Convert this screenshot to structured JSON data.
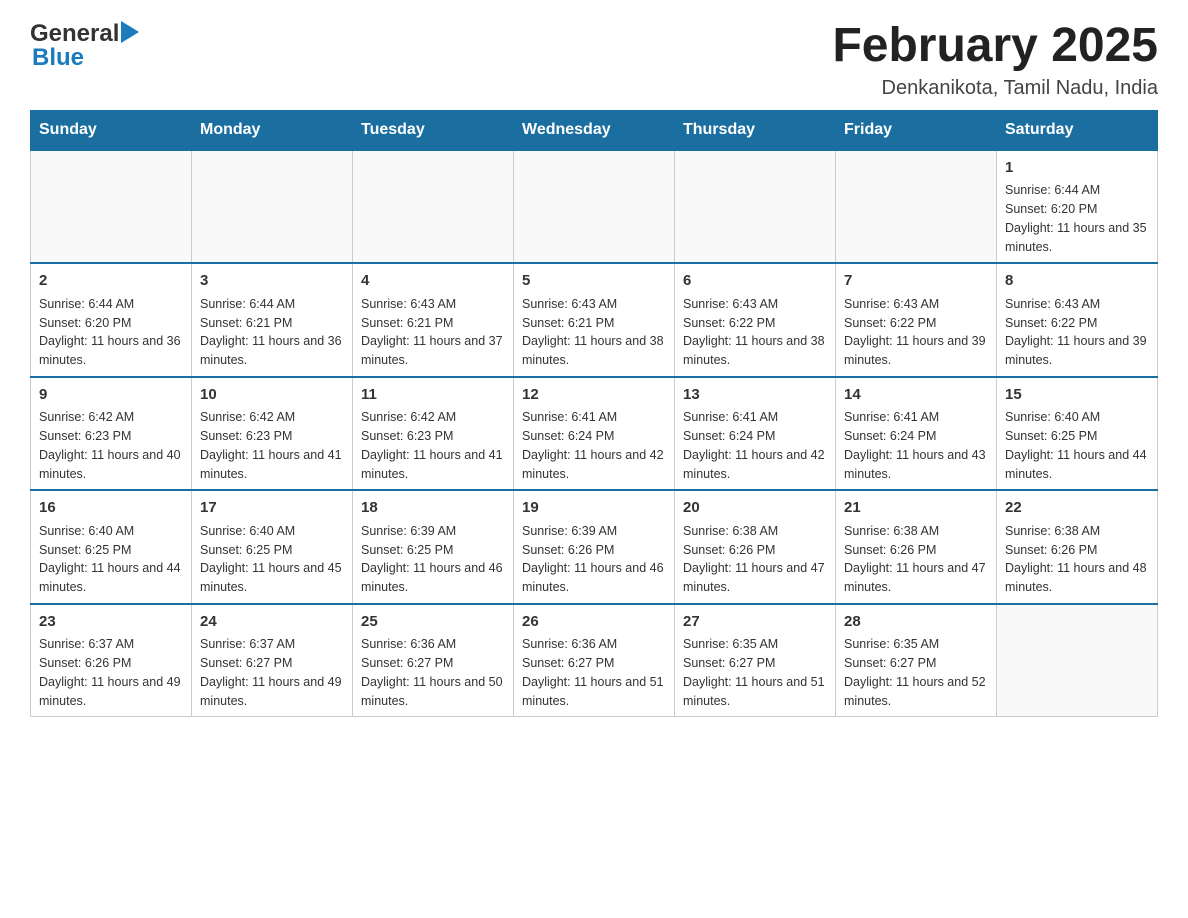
{
  "header": {
    "logo_general": "General",
    "logo_blue": "Blue",
    "month_title": "February 2025",
    "location": "Denkanikota, Tamil Nadu, India"
  },
  "weekdays": [
    "Sunday",
    "Monday",
    "Tuesday",
    "Wednesday",
    "Thursday",
    "Friday",
    "Saturday"
  ],
  "weeks": [
    [
      {
        "day": "",
        "sunrise": "",
        "sunset": "",
        "daylight": ""
      },
      {
        "day": "",
        "sunrise": "",
        "sunset": "",
        "daylight": ""
      },
      {
        "day": "",
        "sunrise": "",
        "sunset": "",
        "daylight": ""
      },
      {
        "day": "",
        "sunrise": "",
        "sunset": "",
        "daylight": ""
      },
      {
        "day": "",
        "sunrise": "",
        "sunset": "",
        "daylight": ""
      },
      {
        "day": "",
        "sunrise": "",
        "sunset": "",
        "daylight": ""
      },
      {
        "day": "1",
        "sunrise": "Sunrise: 6:44 AM",
        "sunset": "Sunset: 6:20 PM",
        "daylight": "Daylight: 11 hours and 35 minutes."
      }
    ],
    [
      {
        "day": "2",
        "sunrise": "Sunrise: 6:44 AM",
        "sunset": "Sunset: 6:20 PM",
        "daylight": "Daylight: 11 hours and 36 minutes."
      },
      {
        "day": "3",
        "sunrise": "Sunrise: 6:44 AM",
        "sunset": "Sunset: 6:21 PM",
        "daylight": "Daylight: 11 hours and 36 minutes."
      },
      {
        "day": "4",
        "sunrise": "Sunrise: 6:43 AM",
        "sunset": "Sunset: 6:21 PM",
        "daylight": "Daylight: 11 hours and 37 minutes."
      },
      {
        "day": "5",
        "sunrise": "Sunrise: 6:43 AM",
        "sunset": "Sunset: 6:21 PM",
        "daylight": "Daylight: 11 hours and 38 minutes."
      },
      {
        "day": "6",
        "sunrise": "Sunrise: 6:43 AM",
        "sunset": "Sunset: 6:22 PM",
        "daylight": "Daylight: 11 hours and 38 minutes."
      },
      {
        "day": "7",
        "sunrise": "Sunrise: 6:43 AM",
        "sunset": "Sunset: 6:22 PM",
        "daylight": "Daylight: 11 hours and 39 minutes."
      },
      {
        "day": "8",
        "sunrise": "Sunrise: 6:43 AM",
        "sunset": "Sunset: 6:22 PM",
        "daylight": "Daylight: 11 hours and 39 minutes."
      }
    ],
    [
      {
        "day": "9",
        "sunrise": "Sunrise: 6:42 AM",
        "sunset": "Sunset: 6:23 PM",
        "daylight": "Daylight: 11 hours and 40 minutes."
      },
      {
        "day": "10",
        "sunrise": "Sunrise: 6:42 AM",
        "sunset": "Sunset: 6:23 PM",
        "daylight": "Daylight: 11 hours and 41 minutes."
      },
      {
        "day": "11",
        "sunrise": "Sunrise: 6:42 AM",
        "sunset": "Sunset: 6:23 PM",
        "daylight": "Daylight: 11 hours and 41 minutes."
      },
      {
        "day": "12",
        "sunrise": "Sunrise: 6:41 AM",
        "sunset": "Sunset: 6:24 PM",
        "daylight": "Daylight: 11 hours and 42 minutes."
      },
      {
        "day": "13",
        "sunrise": "Sunrise: 6:41 AM",
        "sunset": "Sunset: 6:24 PM",
        "daylight": "Daylight: 11 hours and 42 minutes."
      },
      {
        "day": "14",
        "sunrise": "Sunrise: 6:41 AM",
        "sunset": "Sunset: 6:24 PM",
        "daylight": "Daylight: 11 hours and 43 minutes."
      },
      {
        "day": "15",
        "sunrise": "Sunrise: 6:40 AM",
        "sunset": "Sunset: 6:25 PM",
        "daylight": "Daylight: 11 hours and 44 minutes."
      }
    ],
    [
      {
        "day": "16",
        "sunrise": "Sunrise: 6:40 AM",
        "sunset": "Sunset: 6:25 PM",
        "daylight": "Daylight: 11 hours and 44 minutes."
      },
      {
        "day": "17",
        "sunrise": "Sunrise: 6:40 AM",
        "sunset": "Sunset: 6:25 PM",
        "daylight": "Daylight: 11 hours and 45 minutes."
      },
      {
        "day": "18",
        "sunrise": "Sunrise: 6:39 AM",
        "sunset": "Sunset: 6:25 PM",
        "daylight": "Daylight: 11 hours and 46 minutes."
      },
      {
        "day": "19",
        "sunrise": "Sunrise: 6:39 AM",
        "sunset": "Sunset: 6:26 PM",
        "daylight": "Daylight: 11 hours and 46 minutes."
      },
      {
        "day": "20",
        "sunrise": "Sunrise: 6:38 AM",
        "sunset": "Sunset: 6:26 PM",
        "daylight": "Daylight: 11 hours and 47 minutes."
      },
      {
        "day": "21",
        "sunrise": "Sunrise: 6:38 AM",
        "sunset": "Sunset: 6:26 PM",
        "daylight": "Daylight: 11 hours and 47 minutes."
      },
      {
        "day": "22",
        "sunrise": "Sunrise: 6:38 AM",
        "sunset": "Sunset: 6:26 PM",
        "daylight": "Daylight: 11 hours and 48 minutes."
      }
    ],
    [
      {
        "day": "23",
        "sunrise": "Sunrise: 6:37 AM",
        "sunset": "Sunset: 6:26 PM",
        "daylight": "Daylight: 11 hours and 49 minutes."
      },
      {
        "day": "24",
        "sunrise": "Sunrise: 6:37 AM",
        "sunset": "Sunset: 6:27 PM",
        "daylight": "Daylight: 11 hours and 49 minutes."
      },
      {
        "day": "25",
        "sunrise": "Sunrise: 6:36 AM",
        "sunset": "Sunset: 6:27 PM",
        "daylight": "Daylight: 11 hours and 50 minutes."
      },
      {
        "day": "26",
        "sunrise": "Sunrise: 6:36 AM",
        "sunset": "Sunset: 6:27 PM",
        "daylight": "Daylight: 11 hours and 51 minutes."
      },
      {
        "day": "27",
        "sunrise": "Sunrise: 6:35 AM",
        "sunset": "Sunset: 6:27 PM",
        "daylight": "Daylight: 11 hours and 51 minutes."
      },
      {
        "day": "28",
        "sunrise": "Sunrise: 6:35 AM",
        "sunset": "Sunset: 6:27 PM",
        "daylight": "Daylight: 11 hours and 52 minutes."
      },
      {
        "day": "",
        "sunrise": "",
        "sunset": "",
        "daylight": ""
      }
    ]
  ]
}
